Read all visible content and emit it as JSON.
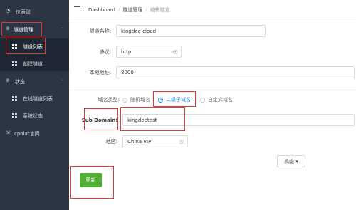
{
  "sidebar": {
    "items": [
      {
        "icon": "dashboard-icon",
        "label": "仪表盘"
      },
      {
        "icon": "tunnel-icon",
        "label": "隧道管理"
      },
      {
        "icon": "grid-icon",
        "label": "隧道列表"
      },
      {
        "icon": "grid-icon",
        "label": "创建隧道"
      },
      {
        "icon": "plus-icon",
        "label": "状态"
      },
      {
        "icon": "grid-icon",
        "label": "在线隧道列表"
      },
      {
        "icon": "grid-icon",
        "label": "系统状态"
      },
      {
        "icon": "link-icon",
        "label": "cpolar官网"
      }
    ]
  },
  "breadcrumb": {
    "home": "Dashboard",
    "section": "隧道管理",
    "current": "编辑隧道"
  },
  "form": {
    "name_label": "隧道名称:",
    "name_value": "kingdee cloud",
    "protocol_label": "协议:",
    "protocol_value": "http",
    "local_label": "本地地址:",
    "local_value": "8000",
    "domain_type_label": "域名类型:",
    "domain_options": [
      "随机域名",
      "二级子域名",
      "自定义域名"
    ],
    "subdomain_label": "Sub Domain:",
    "subdomain_value": "kingdeetest",
    "region_label": "地区:",
    "region_value": "China VIP",
    "advanced_label": "高级 ▾",
    "update_label": "更新"
  },
  "colors": {
    "sidebar_bg": "#2b3544",
    "accent": "#1e88e5",
    "success": "#52b135",
    "highlight": "#e53935"
  }
}
